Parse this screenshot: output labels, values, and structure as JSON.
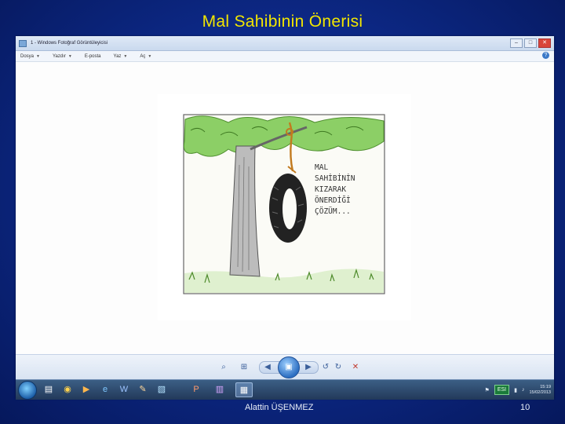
{
  "slide": {
    "title": "Mal Sahibinin Önerisi",
    "author": "Alattin ÜŞENMEZ",
    "page_number": "10"
  },
  "window": {
    "title": "1 - Windows Fotoğraf Görüntüleyicisi",
    "menu": [
      {
        "label": "Dosya",
        "has_dropdown": true
      },
      {
        "label": "Yazdır",
        "has_dropdown": true
      },
      {
        "label": "E-posta",
        "has_dropdown": false
      },
      {
        "label": "Yaz",
        "has_dropdown": true
      },
      {
        "label": "Aç",
        "has_dropdown": true
      }
    ],
    "help_icon": "help-icon"
  },
  "cartoon": {
    "caption_lines": [
      "MAL",
      "SAHİBİNİN",
      "KIZARAK",
      "ÖNERDİĞİ",
      "ÇÖZÜM..."
    ]
  },
  "controls": {
    "icons": [
      "zoom-icon",
      "fit-icon",
      "previous-icon",
      "slideshow-icon",
      "next-icon",
      "rotate-left-icon",
      "rotate-right-icon",
      "delete-icon"
    ]
  },
  "taskbar": {
    "language": "ESI",
    "time": "15:19",
    "date": "15/02/2013",
    "apps": [
      "folder-icon",
      "chrome-icon",
      "media-icon",
      "ie-icon",
      "word-icon",
      "paint-icon",
      "photos-icon",
      "powerpoint-icon",
      "winrar-icon",
      "photo-viewer-icon"
    ]
  },
  "colors": {
    "title": "#f2e600",
    "background": "#0d2a8a",
    "taskbar": "#22395a"
  }
}
